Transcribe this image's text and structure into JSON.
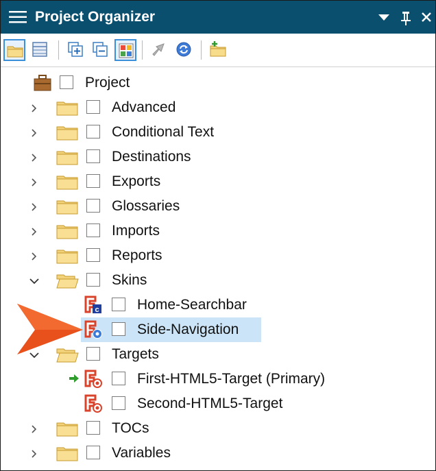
{
  "titlebar": {
    "title": "Project Organizer",
    "controls": [
      "dropdown-arrow-icon",
      "pin-icon",
      "close-icon"
    ],
    "background": "#0b4f6e"
  },
  "toolbar": {
    "buttons": [
      "folder-view-icon",
      "table-view-icon",
      "expand-all-icon",
      "collapse-all-icon",
      "color-grid-icon",
      "publish-icon",
      "refresh-icon",
      "new-folder-icon"
    ],
    "active": [
      "folder-view-icon",
      "color-grid-icon"
    ]
  },
  "tree": {
    "root": {
      "label": "Project",
      "icon": "briefcase-icon"
    },
    "folders": [
      {
        "label": "Advanced"
      },
      {
        "label": "Conditional Text"
      },
      {
        "label": "Destinations"
      },
      {
        "label": "Exports"
      },
      {
        "label": "Glossaries"
      },
      {
        "label": "Imports"
      },
      {
        "label": "Reports"
      },
      {
        "label": "Skins",
        "expanded": true
      },
      {
        "label": "Targets",
        "expanded": true
      },
      {
        "label": "TOCs"
      },
      {
        "label": "Variables"
      }
    ],
    "skins": [
      {
        "label": "Home-Searchbar",
        "icon": "skin-search-icon"
      },
      {
        "label": "Side-Navigation",
        "icon": "skin-navigation-icon",
        "selected": true
      }
    ],
    "targets": [
      {
        "label": "First-HTML5-Target (Primary)",
        "icon": "html5-target-icon",
        "primary": true
      },
      {
        "label": "Second-HTML5-Target",
        "icon": "html5-target-icon"
      }
    ]
  },
  "colors": {
    "selection": "#cce4f7",
    "callout_arrow": "#e8501c",
    "skin_icon": "#d9432b"
  }
}
